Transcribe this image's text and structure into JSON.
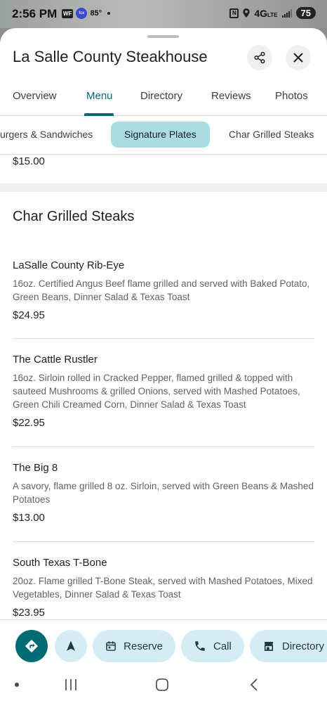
{
  "status_bar": {
    "time": "2:56 PM",
    "wf_badge": "WF",
    "fox_badge": "fox",
    "temperature": "85°",
    "network": "4G",
    "network_suffix": "LTE",
    "battery": "75"
  },
  "header": {
    "title": "La Salle County Steakhouse",
    "share_icon": "share-icon",
    "close_icon": "close-icon"
  },
  "tabs": [
    {
      "label": "Overview",
      "active": false
    },
    {
      "label": "Menu",
      "active": true
    },
    {
      "label": "Directory",
      "active": false
    },
    {
      "label": "Reviews",
      "active": false
    },
    {
      "label": "Photos",
      "active": false
    }
  ],
  "menu_categories": [
    {
      "label": "urgers & Sandwiches",
      "active": false
    },
    {
      "label": "Signature Plates",
      "active": true
    },
    {
      "label": "Char Grilled Steaks",
      "active": false
    }
  ],
  "previous_item_price": "$15.00",
  "section": {
    "title": "Char Grilled Steaks",
    "items": [
      {
        "name": "LaSalle County Rib-Eye",
        "description": "16oz. Certified Angus Beef flame grilled and served with Baked Potato, Green Beans, Dinner Salad & Texas Toast",
        "price": "$24.95"
      },
      {
        "name": "The Cattle Rustler",
        "description": "16oz. Sirloin rolled in Cracked Pepper, flamed grilled & topped with sauteed Mushrooms & grilled Onions, served with Mashed Potatoes, Green Chili Creamed Corn, Dinner Salad & Texas Toast",
        "price": "$22.95"
      },
      {
        "name": "The Big 8",
        "description": "A savory, flame grilled 8 oz. Sirloin, served with Green Beans & Mashed Potatoes",
        "price": "$13.00"
      },
      {
        "name": "South Texas T-Bone",
        "description": "20oz. Flame grilled T-Bone Steak, served with Mashed Potatoes, Mixed Vegetables, Dinner Salad & Texas Toast",
        "price": "$23.95"
      }
    ]
  },
  "actions": {
    "reserve_label": "Reserve",
    "call_label": "Call",
    "directory_label": "Directory"
  },
  "colors": {
    "accent": "#006b73",
    "chip_active": "#a9dde3",
    "pill_bg": "#d3eef2"
  }
}
